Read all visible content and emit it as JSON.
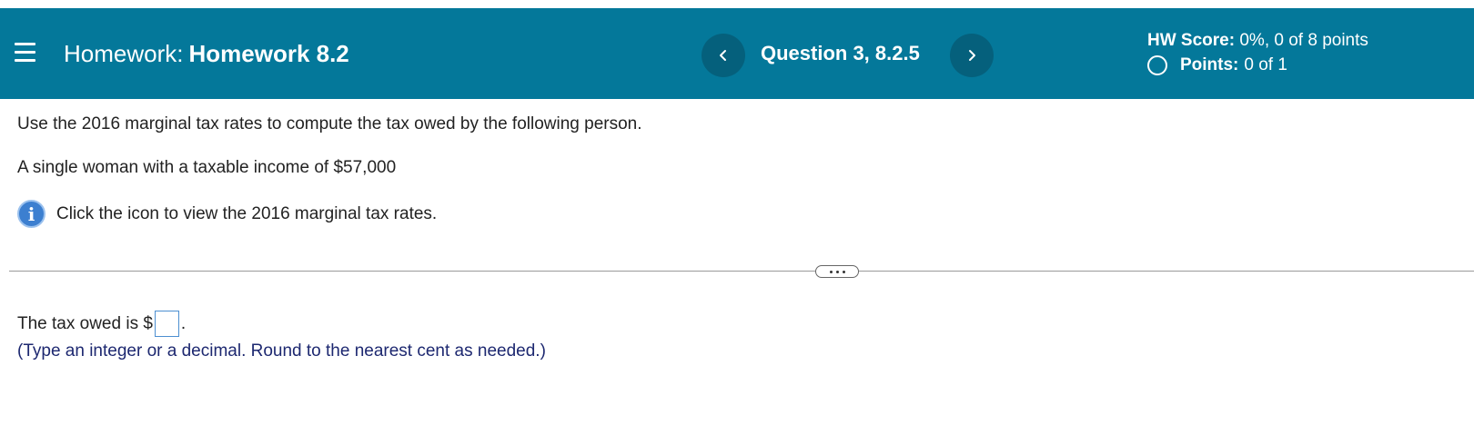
{
  "header": {
    "menu_icon": "hamburger-menu-icon",
    "homework_prefix": "Homework:",
    "homework_name": "Homework 8.2",
    "prev_icon": "chevron-left-icon",
    "next_icon": "chevron-right-icon",
    "question_label": "Question 3, 8.2.5",
    "hw_score_label": "HW Score:",
    "hw_score_value": "0%, 0 of 8 points",
    "points_label": "Points:",
    "points_value": "0 of 1",
    "accent_color": "#04789a"
  },
  "question": {
    "instruction": "Use the 2016 marginal tax rates to compute the tax owed by the following person.",
    "scenario": "A single woman with a taxable income of $57,000",
    "info_icon": "info-icon",
    "info_text": "Click the icon to view the 2016 marginal tax rates."
  },
  "answer": {
    "prefix": "The tax owed is $",
    "input_value": "",
    "suffix": ".",
    "hint": "(Type an integer or a decimal. Round to the nearest cent as needed.)"
  }
}
